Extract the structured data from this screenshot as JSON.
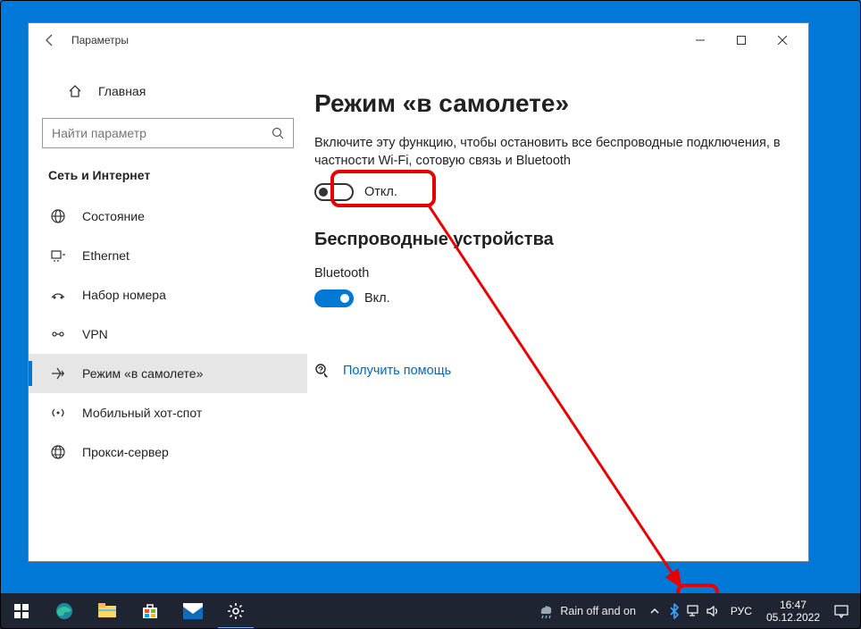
{
  "window": {
    "title": "Параметры",
    "sidebar": {
      "home_label": "Главная",
      "search_placeholder": "Найти параметр",
      "section": "Сеть и Интернет",
      "items": [
        {
          "label": "Состояние"
        },
        {
          "label": "Ethernet"
        },
        {
          "label": "Набор номера"
        },
        {
          "label": "VPN"
        },
        {
          "label": "Режим «в самолете»"
        },
        {
          "label": "Мобильный хот-спот"
        },
        {
          "label": "Прокси-сервер"
        }
      ]
    },
    "content": {
      "heading": "Режим «в самолете»",
      "description": "Включите эту функцию, чтобы остановить все беспроводные подключения, в частности Wi-Fi, сотовую связь и Bluetooth",
      "airplane_toggle_label": "Откл.",
      "wireless_heading": "Беспроводные устройства",
      "bt_label": "Bluetooth",
      "bt_toggle_label": "Вкл.",
      "help_link": "Получить помощь"
    }
  },
  "taskbar": {
    "weather": "Rain off and on",
    "lang": "РУС",
    "time": "16:47",
    "date": "05.12.2022"
  }
}
